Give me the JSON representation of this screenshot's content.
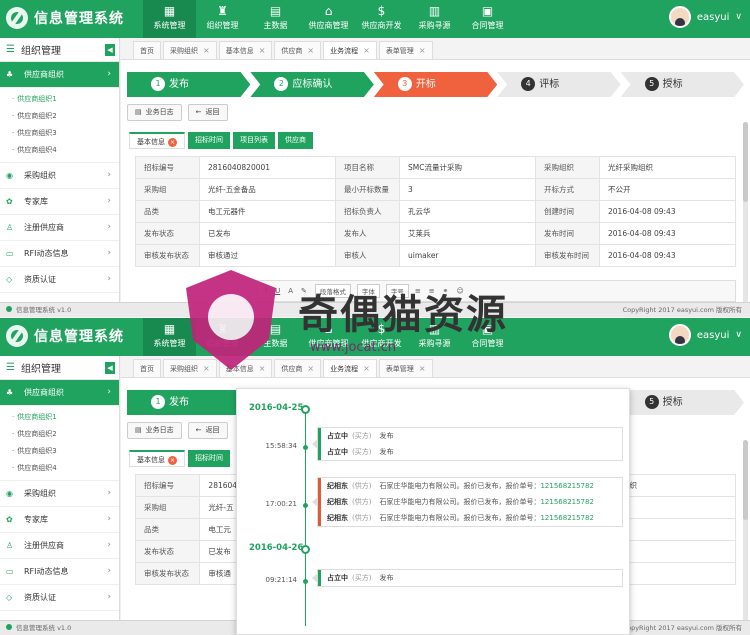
{
  "app": {
    "title": "信息管理系统",
    "version_label": "信息管理系统 v1.0",
    "copyright": "CopyRight 2017  easyui.com 版权所有"
  },
  "nav": [
    {
      "label": "系统管理",
      "icon": "grid-icon"
    },
    {
      "label": "组织管理",
      "icon": "org-icon"
    },
    {
      "label": "主数据",
      "icon": "doc-icon"
    },
    {
      "label": "供应商管理",
      "icon": "supplier-icon"
    },
    {
      "label": "供应商开发",
      "icon": "dev-icon"
    },
    {
      "label": "采购寻源",
      "icon": "cart-icon"
    },
    {
      "label": "合同管理",
      "icon": "contract-icon"
    }
  ],
  "nav2": [
    {
      "label": "系统管理"
    },
    {
      "label": "组织管理"
    },
    {
      "label": "主数据"
    },
    {
      "label": "供应商管理"
    },
    {
      "label": "供应商开发"
    },
    {
      "label": "采购寻源"
    },
    {
      "label": "合同管理"
    }
  ],
  "user": {
    "name": "easyui"
  },
  "sidebar": {
    "title": "组织管理",
    "groups": [
      {
        "label": "供应商组织"
      },
      {
        "label": "采购组织"
      },
      {
        "label": "专家库"
      },
      {
        "label": "注册供应商"
      },
      {
        "label": "RFI动态信息"
      },
      {
        "label": "资质认证"
      }
    ],
    "subs": [
      "供应商组织1",
      "供应商组织2",
      "供应商组织3",
      "供应商组织4"
    ]
  },
  "tabs": [
    "首页",
    "采购组织",
    "基本信息",
    "供应商",
    "业务流程",
    "表单管理"
  ],
  "flow": [
    {
      "num": "1",
      "label": "发布"
    },
    {
      "num": "2",
      "label": "应标确认"
    },
    {
      "num": "3",
      "label": "开标"
    },
    {
      "num": "4",
      "label": "评标"
    },
    {
      "num": "5",
      "label": "授标"
    }
  ],
  "buttons": {
    "log": "业务日志",
    "back": "返回"
  },
  "inner_tabs": [
    "基本信息",
    "招标时间",
    "项目列表",
    "供应商"
  ],
  "info": [
    [
      "招标编号",
      "2816040820001",
      "项目名称",
      "SMC流量计采购",
      "采购组织",
      "光纤采购组织"
    ],
    [
      "采购组",
      "光纤-五金备品",
      "最小开标数量",
      "3",
      "开标方式",
      "不公开"
    ],
    [
      "品类",
      "电工元器件",
      "招标负责人",
      "孔云华",
      "创建时间",
      "2016-04-08 09:43"
    ],
    [
      "发布状态",
      "已发布",
      "发布人",
      "艾莱兵",
      "发布时间",
      "2016-04-08 09:43"
    ],
    [
      "审核发布状态",
      "审核通过",
      "审核人",
      "uimaker",
      "审核发布时间",
      "2016-04-08 09:43"
    ]
  ],
  "info2": [
    [
      "招标编号",
      "281604",
      "采购组织"
    ],
    [
      "采购组",
      "光纤-五",
      "开"
    ],
    [
      "品类",
      "电工元",
      "09:43"
    ],
    [
      "发布状态",
      "已发布",
      "09:43"
    ],
    [
      "审核发布状态",
      "审核通",
      "09:43"
    ]
  ],
  "editor": {
    "para": "段落格式",
    "font": "字体",
    "size": "字号"
  },
  "timeline": {
    "dates": [
      "2016-04-25",
      "2016-04-26"
    ],
    "entries": [
      {
        "time": "15:58:34",
        "rows": [
          {
            "name": "占立中",
            "role": "(买方)",
            "action": "发布",
            "id": ""
          },
          {
            "name": "占立中",
            "role": "(买方)",
            "action": "发布",
            "id": ""
          }
        ]
      },
      {
        "time": "17:00:21",
        "rows": [
          {
            "name": "纪相东",
            "role": "(供方)",
            "action": "石家庄华能电力有限公司。报价已发布，报价单号：",
            "id": "121568215782"
          },
          {
            "name": "纪相东",
            "role": "(供方)",
            "action": "石家庄华能电力有限公司。报价已发布，报价单号：",
            "id": "121568215782"
          },
          {
            "name": "纪相东",
            "role": "(供方)",
            "action": "石家庄华能电力有限公司。报价已发布，报价单号：",
            "id": "121568215782"
          }
        ]
      },
      {
        "time": "09:21:14",
        "rows": [
          {
            "name": "占立中",
            "role": "(买方)",
            "action": "发布",
            "id": ""
          }
        ]
      }
    ]
  },
  "watermark": {
    "text": "奇偶猫资源",
    "url": "www.jocat.cn"
  },
  "colors": {
    "primary": "#21a360",
    "accent": "#f0613d"
  }
}
